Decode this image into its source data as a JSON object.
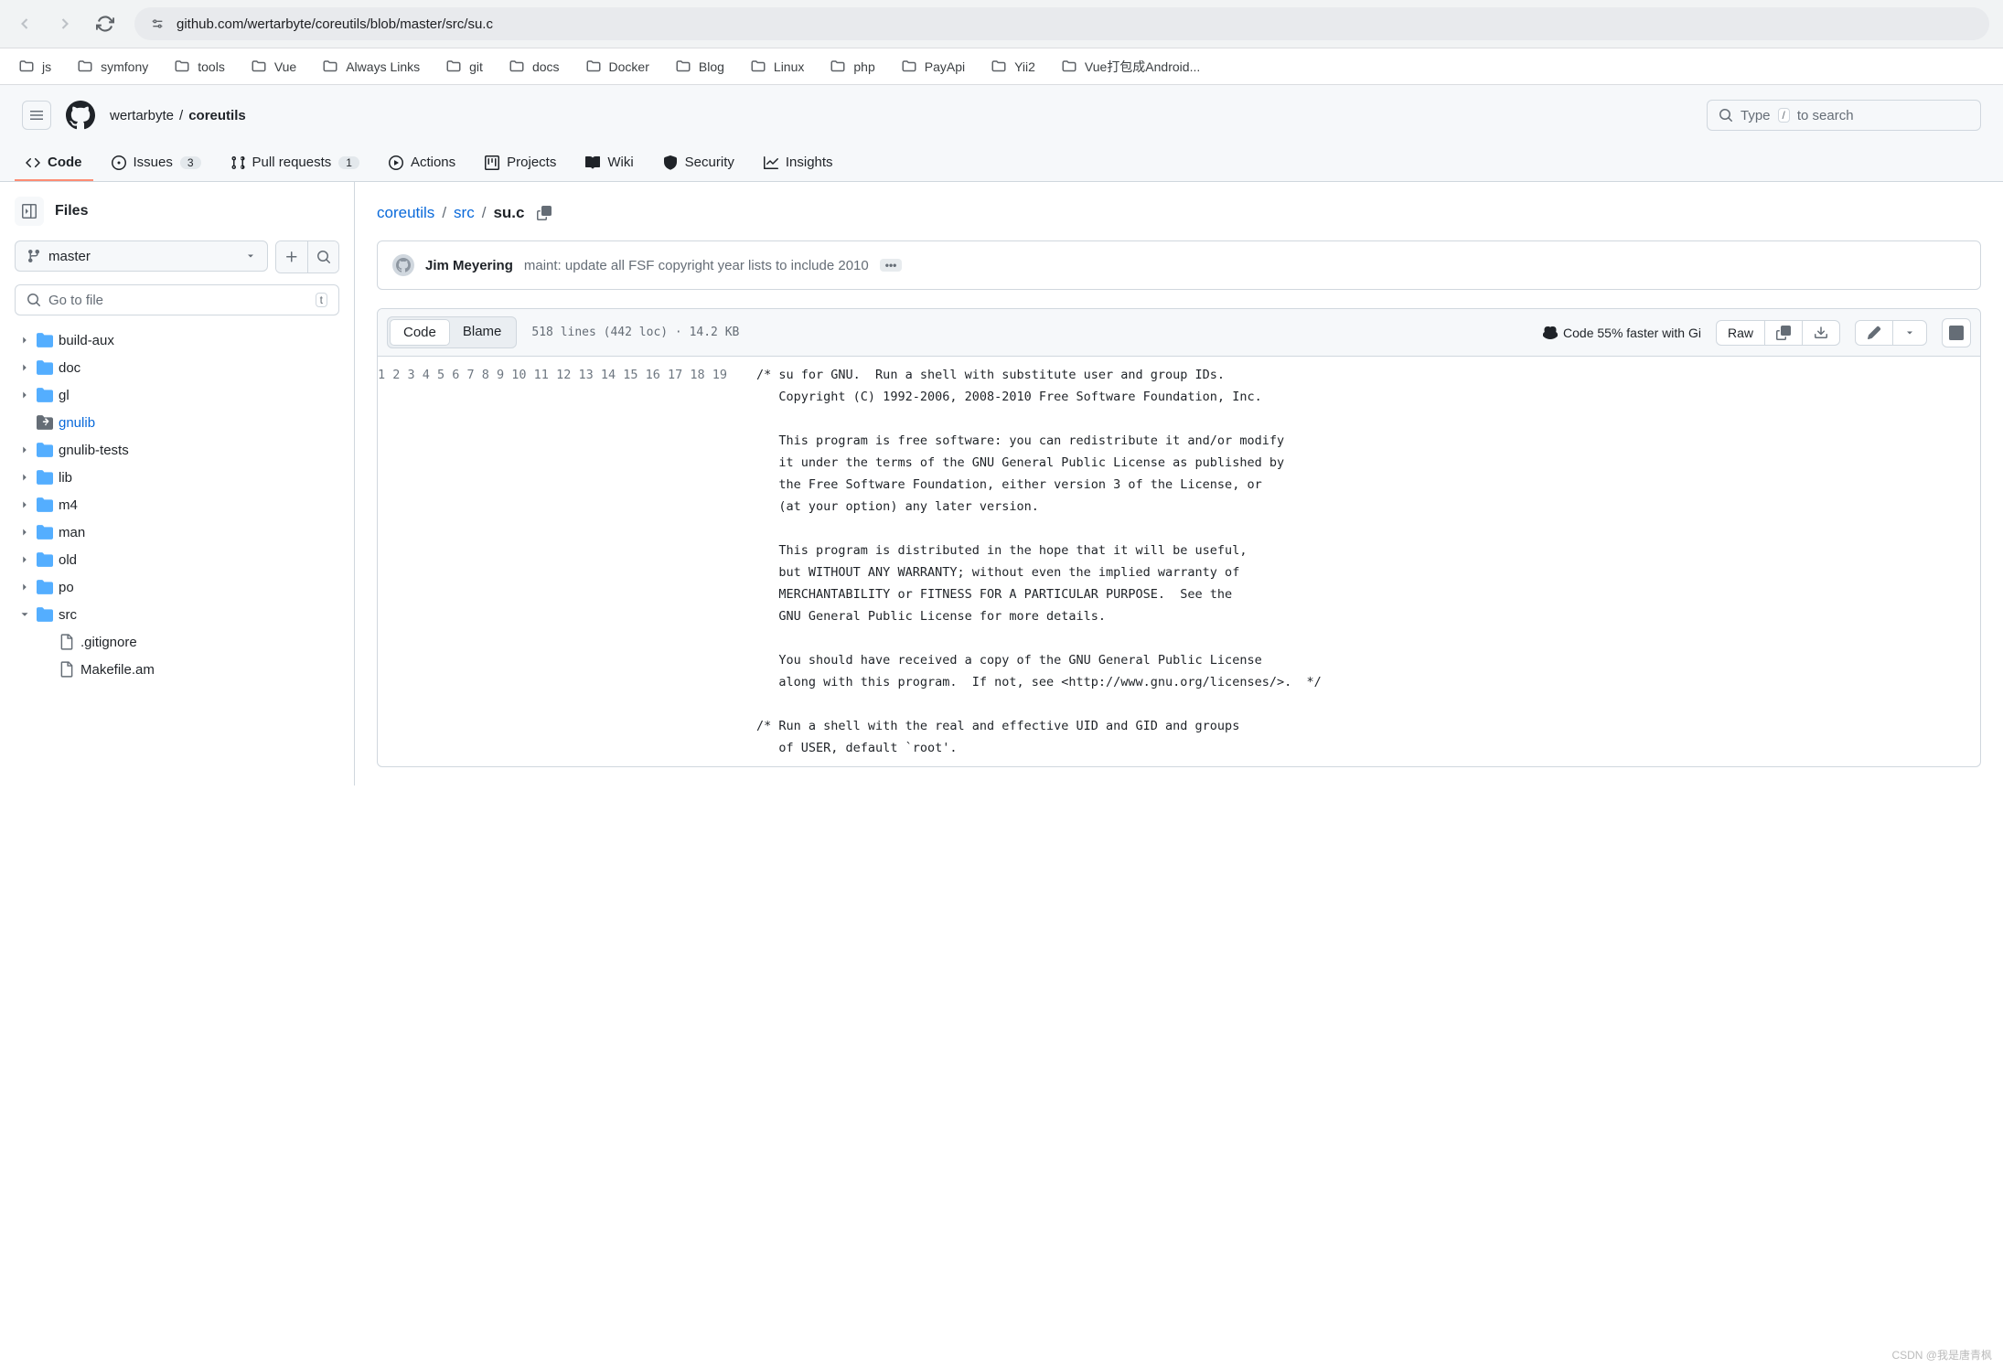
{
  "browser": {
    "url": "github.com/wertarbyte/coreutils/blob/master/src/su.c"
  },
  "bookmarks": [
    "js",
    "symfony",
    "tools",
    "Vue",
    "Always Links",
    "git",
    "docs",
    "Docker",
    "Blog",
    "Linux",
    "php",
    "PayApi",
    "Yii2",
    "Vue打包成Android..."
  ],
  "header": {
    "owner": "wertarbyte",
    "repo": "coreutils",
    "search_placeholder": "Type",
    "search_suffix": "to search",
    "search_key": "/"
  },
  "tabs": {
    "code": "Code",
    "issues": "Issues",
    "issues_count": "3",
    "pulls": "Pull requests",
    "pulls_count": "1",
    "actions": "Actions",
    "projects": "Projects",
    "wiki": "Wiki",
    "security": "Security",
    "insights": "Insights"
  },
  "sidebar": {
    "title": "Files",
    "branch": "master",
    "goto": "Go to file",
    "goto_key": "t",
    "tree": [
      {
        "type": "folder",
        "name": "build-aux",
        "expand": true
      },
      {
        "type": "folder",
        "name": "doc",
        "expand": true
      },
      {
        "type": "folder",
        "name": "gl",
        "expand": true
      },
      {
        "type": "submodule",
        "name": "gnulib",
        "expand": false
      },
      {
        "type": "folder",
        "name": "gnulib-tests",
        "expand": true
      },
      {
        "type": "folder",
        "name": "lib",
        "expand": true
      },
      {
        "type": "folder",
        "name": "m4",
        "expand": true
      },
      {
        "type": "folder",
        "name": "man",
        "expand": true
      },
      {
        "type": "folder",
        "name": "old",
        "expand": true
      },
      {
        "type": "folder",
        "name": "po",
        "expand": true
      },
      {
        "type": "folder",
        "name": "src",
        "expand": true,
        "open": true
      },
      {
        "type": "file",
        "name": ".gitignore",
        "indent": 1
      },
      {
        "type": "file",
        "name": "Makefile.am",
        "indent": 1
      }
    ]
  },
  "breadcrumb": {
    "root": "coreutils",
    "dir": "src",
    "file": "su.c"
  },
  "commit": {
    "author": "Jim Meyering",
    "message": "maint: update all FSF copyright year lists to include 2010",
    "ellipsis": "•••"
  },
  "file_toolbar": {
    "code": "Code",
    "blame": "Blame",
    "info": "518 lines (442 loc) · 14.2 KB",
    "copilot": "Code 55% faster with Gi",
    "raw": "Raw"
  },
  "code": {
    "lines": [
      "/* su for GNU.  Run a shell with substitute user and group IDs.",
      "   Copyright (C) 1992-2006, 2008-2010 Free Software Foundation, Inc.",
      "",
      "   This program is free software: you can redistribute it and/or modify",
      "   it under the terms of the GNU General Public License as published by",
      "   the Free Software Foundation, either version 3 of the License, or",
      "   (at your option) any later version.",
      "",
      "   This program is distributed in the hope that it will be useful,",
      "   but WITHOUT ANY WARRANTY; without even the implied warranty of",
      "   MERCHANTABILITY or FITNESS FOR A PARTICULAR PURPOSE.  See the",
      "   GNU General Public License for more details.",
      "",
      "   You should have received a copy of the GNU General Public License",
      "   along with this program.  If not, see <http://www.gnu.org/licenses/>.  */",
      "",
      "/* Run a shell with the real and effective UID and GID and groups",
      "   of USER, default `root'.",
      ""
    ]
  },
  "watermark": "CSDN @我是唐青枫"
}
